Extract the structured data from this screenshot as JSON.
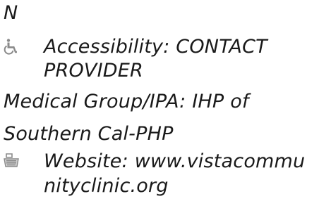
{
  "fragment_top": "N",
  "accessibility": {
    "icon": "wheelchair-icon",
    "line1": "Accessibility: CONTACT",
    "line2": "PROVIDER"
  },
  "medical_group": {
    "line1": "Medical Group/IPA: IHP of",
    "line2": "Southern Cal-PHP"
  },
  "website": {
    "icon": "keyboard-icon",
    "line1": "Website: www.vistacommu",
    "line2": "nityclinic.org"
  },
  "colors": {
    "text": "#1a1a1a",
    "icon": "#8a8a8a"
  }
}
